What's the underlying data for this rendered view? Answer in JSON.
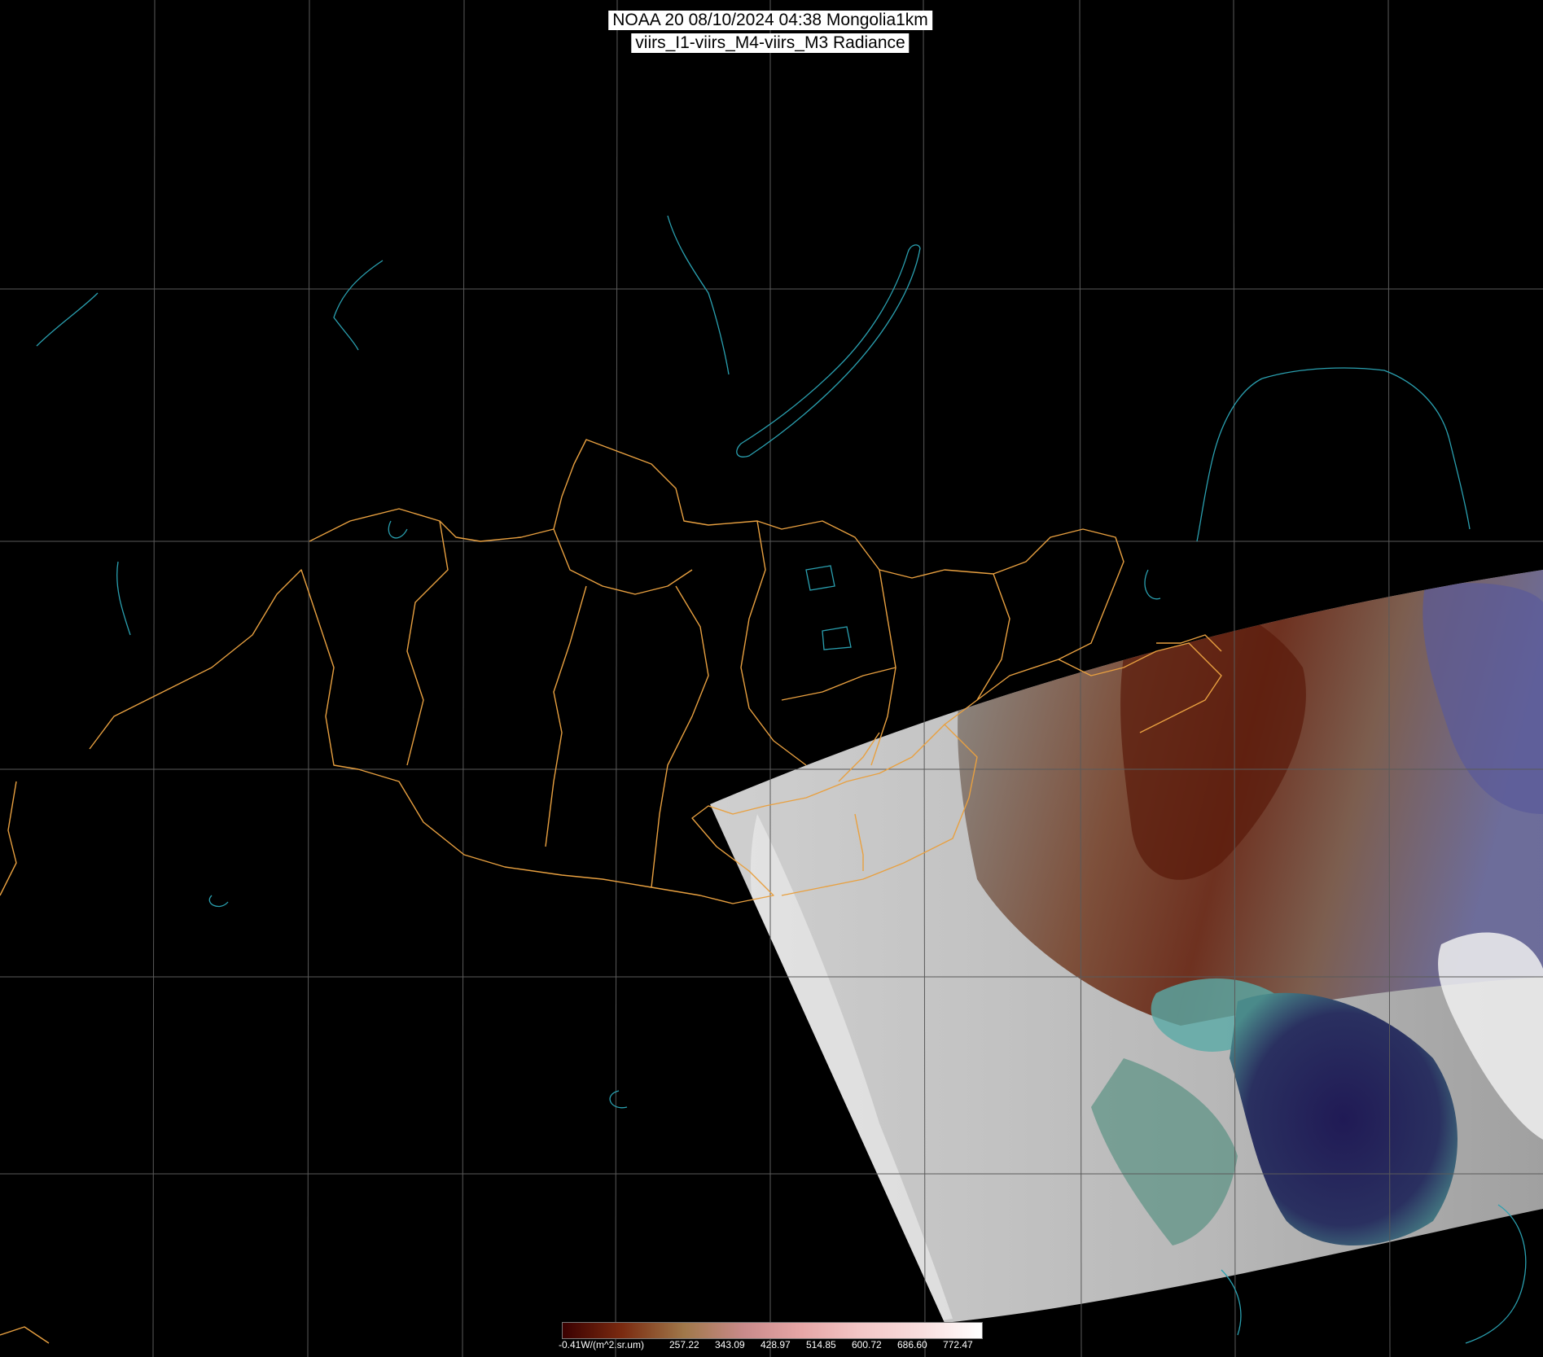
{
  "title": {
    "line1": "NOAA 20 08/10/2024 04:38 Mongolia1km",
    "line2": "viirs_I1-viirs_M4-viirs_M3 Radiance"
  },
  "colors": {
    "background": "#000000",
    "graticule": "#5a5a5a",
    "province_borders": "#e8a040",
    "coastlines_lakes": "#2aa0b0",
    "cloud": "#e6e6e6",
    "land_brown": "#7a3a20",
    "sea_blue": "#2a2860",
    "sediment_cyan": "#6ab4b0"
  },
  "colorbar": {
    "unit_label": "-0.41W/(m^2.sr.um)",
    "ticks": [
      "257.22",
      "343.09",
      "428.97",
      "514.85",
      "600.72",
      "686.60",
      "772.47"
    ],
    "stops": [
      "#3a0000",
      "#7a2a10",
      "#a0784a",
      "#c98a8a",
      "#e6a6a6",
      "#f2c6c6",
      "#f8dede",
      "#ffffff"
    ]
  }
}
